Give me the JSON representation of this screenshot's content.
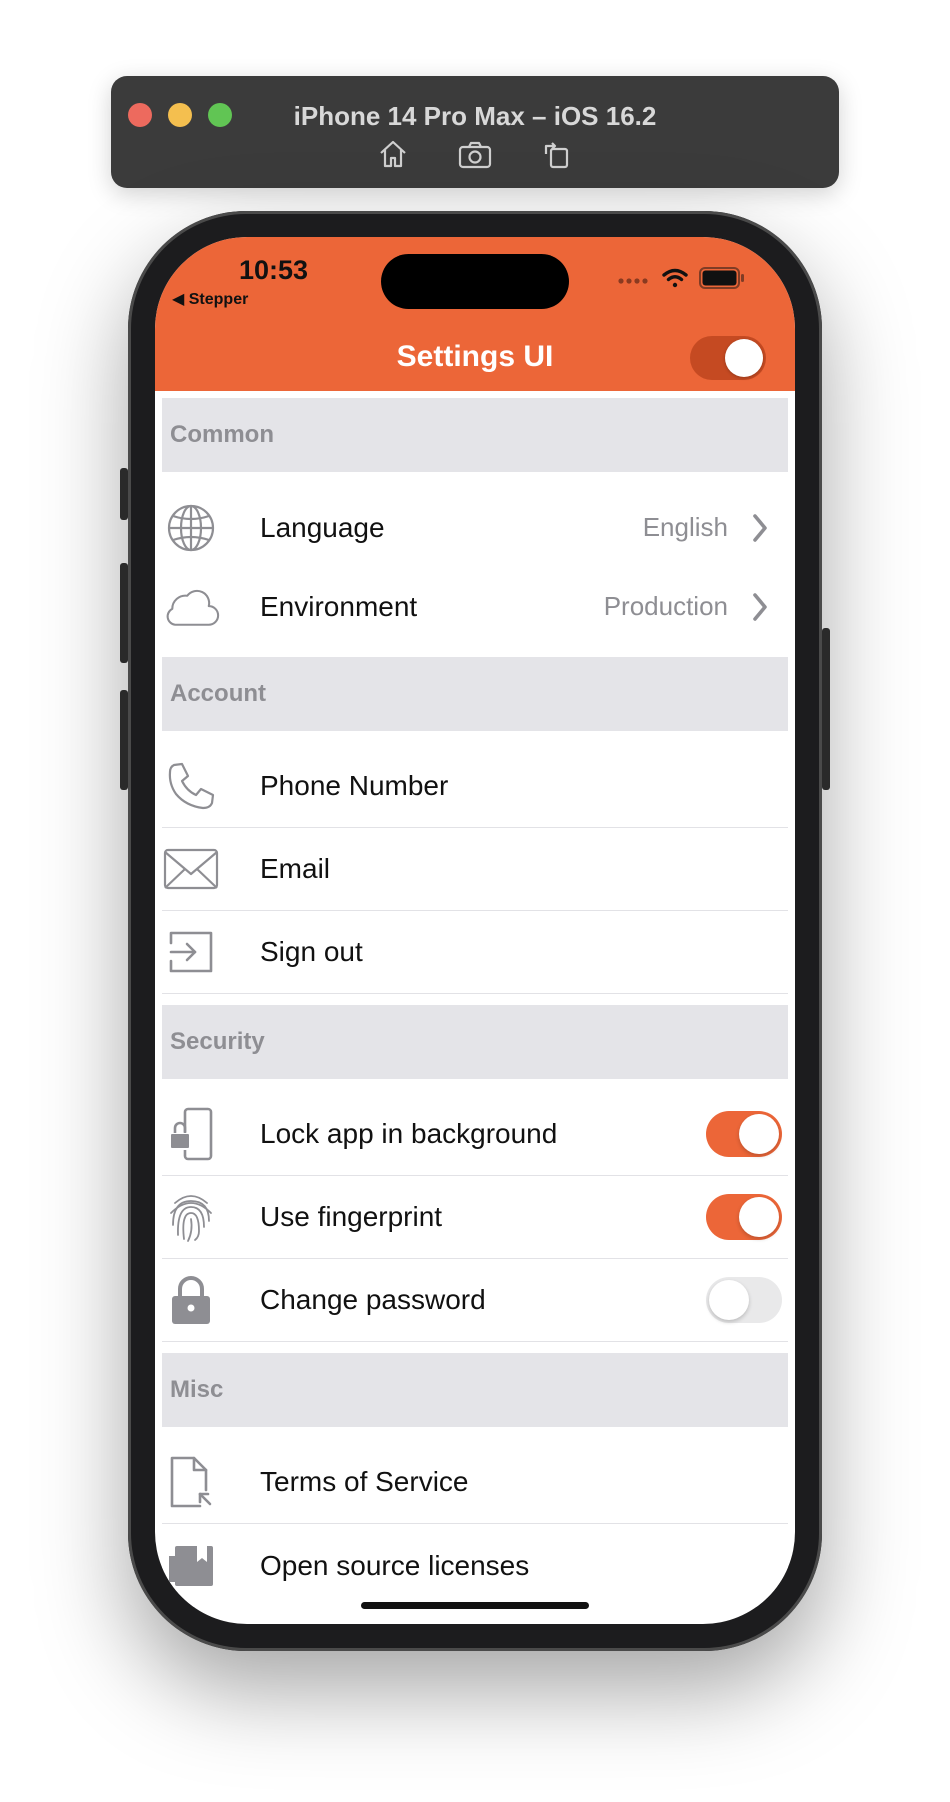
{
  "simulator": {
    "title": "iPhone 14 Pro Max – iOS 16.2"
  },
  "status_bar": {
    "time": "10:53",
    "back_app": "◀ Stepper"
  },
  "header": {
    "title": "Settings UI",
    "toggle_on": true,
    "accent_color": "#ec6638"
  },
  "sections": {
    "common": {
      "title": "Common",
      "language": {
        "label": "Language",
        "value": "English",
        "icon": "globe-icon"
      },
      "environment": {
        "label": "Environment",
        "value": "Production",
        "icon": "cloud-icon"
      }
    },
    "account": {
      "title": "Account",
      "phone": {
        "label": "Phone Number",
        "icon": "phone-icon"
      },
      "email": {
        "label": "Email",
        "icon": "envelope-icon"
      },
      "signout": {
        "label": "Sign out",
        "icon": "sign-out-icon"
      }
    },
    "security": {
      "title": "Security",
      "lock_app": {
        "label": "Lock app in background",
        "on": true,
        "icon": "phone-lock-icon"
      },
      "fingerprint": {
        "label": "Use fingerprint",
        "on": true,
        "icon": "fingerprint-icon"
      },
      "change_password": {
        "label": "Change password",
        "on": false,
        "icon": "padlock-icon"
      }
    },
    "misc": {
      "title": "Misc",
      "terms": {
        "label": "Terms of Service",
        "icon": "document-icon"
      },
      "licenses": {
        "label": "Open source licenses",
        "icon": "book-icon"
      }
    }
  }
}
